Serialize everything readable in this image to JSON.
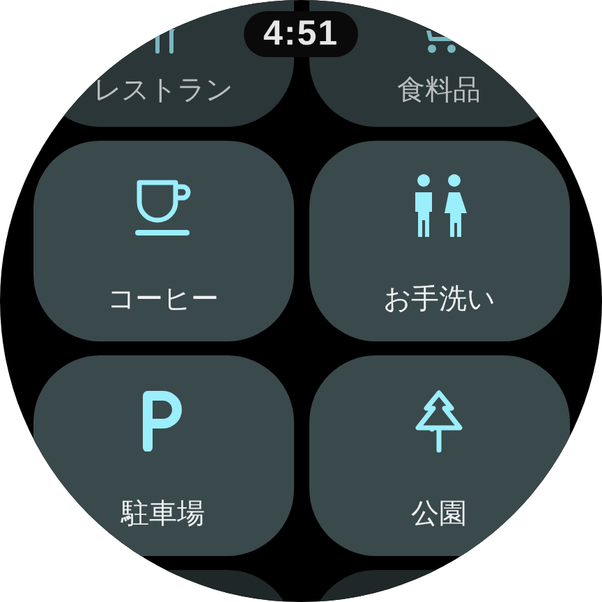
{
  "clock": {
    "time": "4:51"
  },
  "tiles": [
    {
      "kind": "restaurant",
      "label": "レストラン"
    },
    {
      "kind": "grocery",
      "label": "食料品"
    },
    {
      "kind": "coffee",
      "label": "コーヒー"
    },
    {
      "kind": "restroom",
      "label": "お手洗い"
    },
    {
      "kind": "parking",
      "label": "駐車場"
    },
    {
      "kind": "park",
      "label": "公園"
    }
  ]
}
